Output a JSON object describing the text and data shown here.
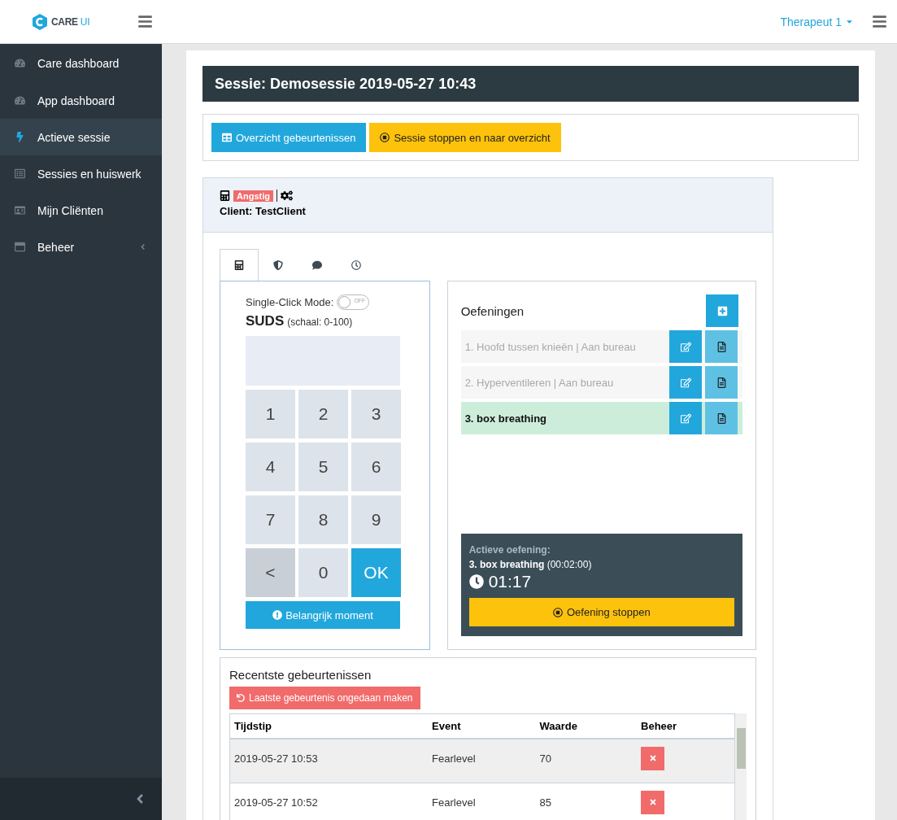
{
  "brand": {
    "name": "CARE",
    "suffix": "UI"
  },
  "user": {
    "name": "Therapeut 1"
  },
  "sidebar": {
    "items": [
      {
        "label": "Care dashboard",
        "selected": false,
        "has_submenu": false
      },
      {
        "label": "App dashboard",
        "selected": false,
        "has_submenu": false
      },
      {
        "label": "Actieve sessie",
        "selected": true,
        "has_submenu": false
      },
      {
        "label": "Sessies en huiswerk",
        "selected": false,
        "has_submenu": false
      },
      {
        "label": "Mijn Cliënten",
        "selected": false,
        "has_submenu": false
      },
      {
        "label": "Beheer",
        "selected": false,
        "has_submenu": true
      }
    ]
  },
  "session": {
    "title": "Sessie: Demosessie 2019-05-27 10:43",
    "actions": [
      {
        "label": "Overzicht gebeurtenissen",
        "kind": "primary"
      },
      {
        "label": "Sessie stoppen en naar overzicht",
        "kind": "warning"
      }
    ]
  },
  "client": {
    "tag": "Angstig",
    "name": "Client: TestClient"
  },
  "tabs": [
    {
      "selected": true
    },
    {
      "selected": false
    },
    {
      "selected": false
    },
    {
      "selected": false
    }
  ],
  "keypad": {
    "toggle": {
      "label": "Single-Click Mode:",
      "on": false,
      "text": "OFF"
    },
    "title": "SUDS",
    "scale": "(schaal: 0-100)",
    "keys": [
      {
        "label": "1",
        "kind": "digit"
      },
      {
        "label": "2",
        "kind": "digit"
      },
      {
        "label": "3",
        "kind": "digit"
      },
      {
        "label": "4",
        "kind": "digit"
      },
      {
        "label": "5",
        "kind": "digit"
      },
      {
        "label": "6",
        "kind": "digit"
      },
      {
        "label": "7",
        "kind": "digit"
      },
      {
        "label": "8",
        "kind": "digit"
      },
      {
        "label": "9",
        "kind": "digit"
      },
      {
        "label": "<",
        "kind": "back"
      },
      {
        "label": "0",
        "kind": "digit"
      },
      {
        "label": "OK",
        "kind": "ok"
      }
    ],
    "moment_button": "Belangrijk moment"
  },
  "exercises": {
    "title": "Oefeningen",
    "items": [
      {
        "label": "1. Hoofd tussen knieën | Aan bureau",
        "active": false
      },
      {
        "label": "2. Hyperventileren | Aan bureau",
        "active": false
      },
      {
        "label": "3. box breathing",
        "active": true
      }
    ],
    "active": {
      "heading": "Actieve oefening:",
      "name": "3. box breathing",
      "duration": "(00:02:00)",
      "timer": "01:17",
      "stop_button": "Oefening stoppen"
    }
  },
  "events": {
    "title": "Recentste gebeurtenissen",
    "undo_button": "Laatste gebeurtenis ongedaan maken",
    "columns": [
      "Tijdstip",
      "Event",
      "Waarde",
      "Beheer"
    ],
    "rows": [
      {
        "time": "2019-05-27 10:53",
        "event": "Fearlevel",
        "value": "70"
      },
      {
        "time": "2019-05-27 10:52",
        "event": "Fearlevel",
        "value": "85"
      }
    ]
  }
}
